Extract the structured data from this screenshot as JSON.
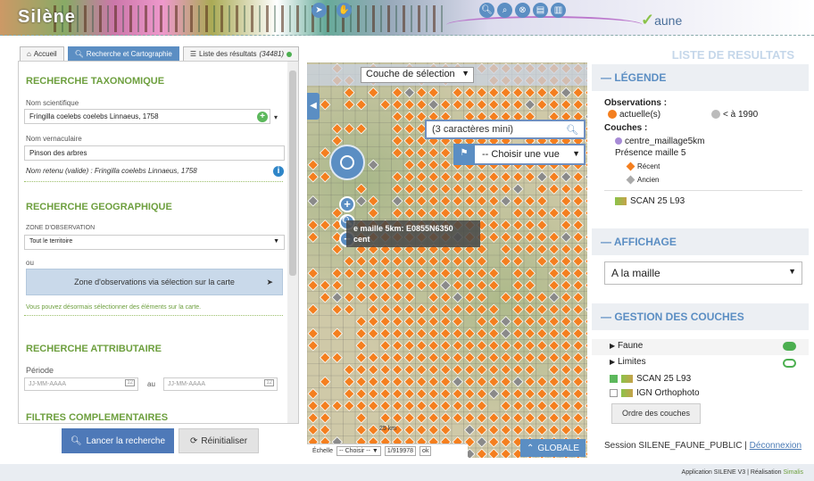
{
  "banner": {
    "brand": "Silène",
    "product": "aune"
  },
  "tabs": [
    {
      "label": "Accueil"
    },
    {
      "label": "Recherche et Cartographie"
    },
    {
      "label": "Liste des résultats",
      "count": "(34481)"
    }
  ],
  "results_title": "LISTE DE RESULTATS",
  "search": {
    "taxo_title": "RECHERCHE TAXONOMIQUE",
    "sci_label": "Nom scientifique",
    "sci_value": "Fringilla coelebs coelebs Linnaeus, 1758",
    "vern_label": "Nom vernaculaire",
    "vern_value": "Pinson des arbres",
    "retained_name": "Nom retenu (valide) : Fringilla coelebs Linnaeus, 1758",
    "geo_title": "RECHERCHE GEOGRAPHIQUE",
    "zone_label": "ZONE D'OBSERVATION",
    "zone_value": "Tout le territoire",
    "or_label": "ou",
    "zone_btn": "Zone d'observations via sélection sur la carte",
    "select_hint": "Vous pouvez désormais sélectionner des éléments sur la carte.",
    "attr_title": "RECHERCHE ATTRIBUTAIRE",
    "period_label": "Période",
    "date_placeholder": "JJ-MM-AAAA",
    "date_sep": "au",
    "filters_title": "FILTRES COMPLEMENTAIRES",
    "launch_btn": "Lancer la recherche",
    "reset_btn": "Réinitialiser"
  },
  "map": {
    "layer_select": "Couche de sélection",
    "search_placeholder": "(3 caractères mini)",
    "view_select": "-- Choisir une vue",
    "tooltip_line1": "e maille 5km: E0855N6350",
    "tooltip_line2": "cent",
    "scale_label": "Échelle",
    "scale_select": "-- Choisir --",
    "scale_prefix": "1/",
    "scale_value": "919978",
    "scale_ok": "ok",
    "scale_km": "25 km",
    "globale_btn": "GLOBALE"
  },
  "legend": {
    "title": "LÉGENDE",
    "obs_label": "Observations :",
    "current": "actuelle(s)",
    "old": "< à 1990",
    "layers_label": "Couches :",
    "layer_centre": "centre_maillage5km",
    "presence": "Présence maille 5",
    "recent": "Récent",
    "ancien": "Ancien",
    "scan": "SCAN 25 L93",
    "colors": {
      "orange": "#f47f1f",
      "grey": "#8a8a8a",
      "purple": "#a78bd6",
      "accent": "#5b8ec3"
    }
  },
  "display": {
    "title": "AFFICHAGE",
    "value": "A la maille"
  },
  "layers": {
    "title": "GESTION DES COUCHES",
    "faune": "Faune",
    "limites": "Limites",
    "scan": "SCAN 25 L93",
    "ortho": "IGN Orthophoto",
    "order_btn": "Ordre des couches"
  },
  "session": {
    "label": "Session SILENE_FAUNE_PUBLIC |",
    "logout": "Déconnexion"
  },
  "footer": {
    "text": "Application SILENE V3 | Réalisation",
    "brand": "Simalis"
  }
}
